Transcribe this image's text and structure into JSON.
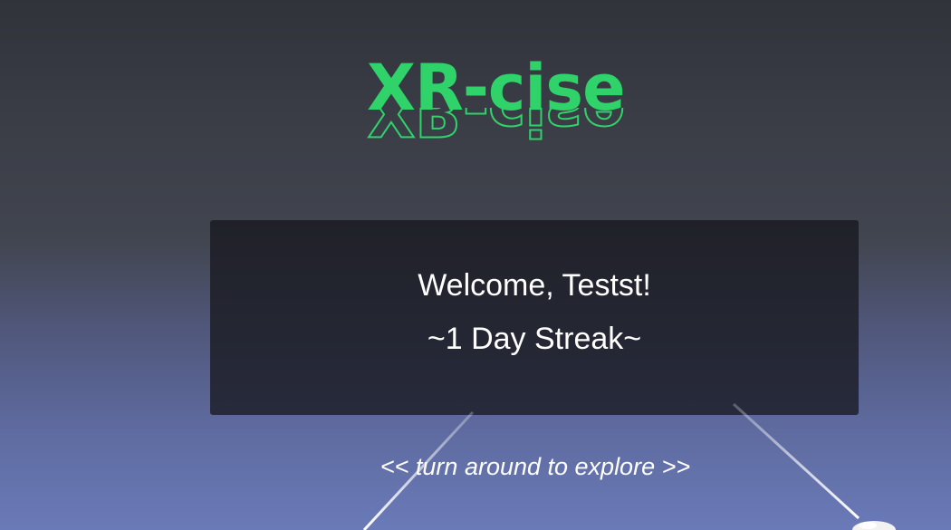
{
  "app": {
    "logo_text": "XR-cise",
    "logo_color": "#2fd36a"
  },
  "welcome_panel": {
    "greeting": "Welcome, Testst!",
    "streak": "~1 Day Streak~"
  },
  "hint": {
    "text": "<<   turn around to explore  >>"
  },
  "controllers": {
    "left_pointer": "laser-pointer",
    "right_pointer": "laser-pointer",
    "right_controller_icon": "vr-controller-icon"
  }
}
